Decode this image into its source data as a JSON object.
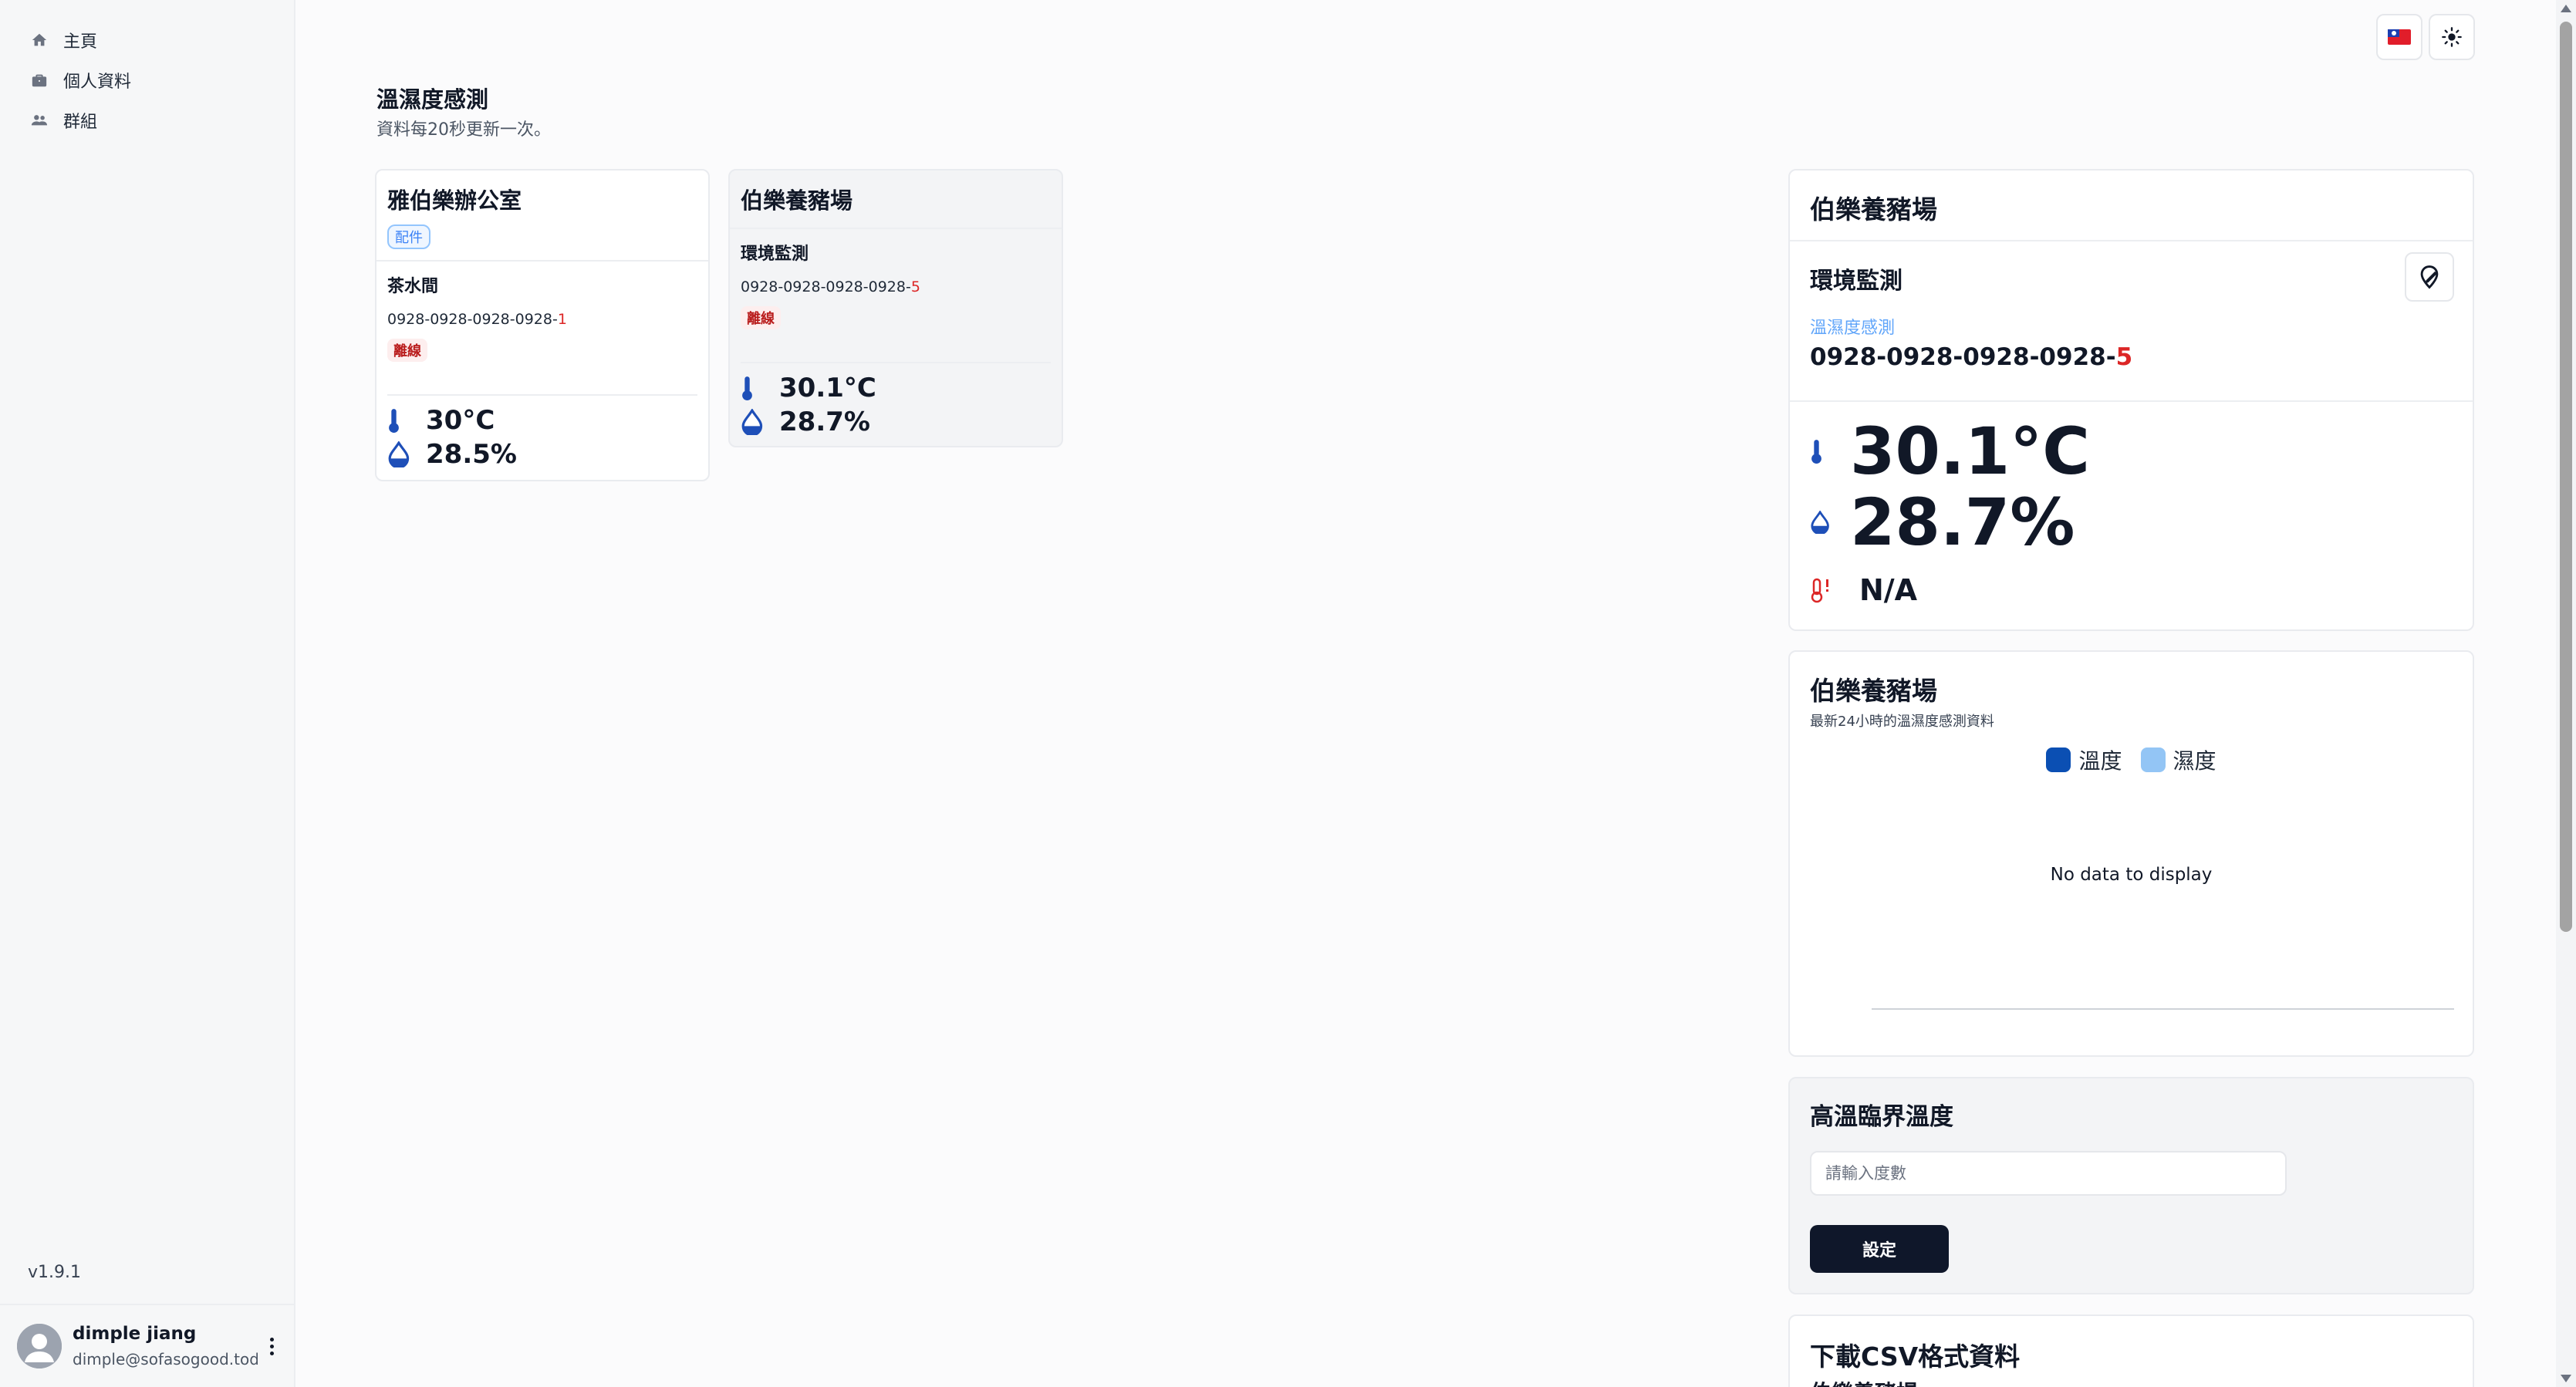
{
  "sidebar": {
    "items": [
      {
        "label": "主頁",
        "icon": "home-icon"
      },
      {
        "label": "個人資料",
        "icon": "briefcase-icon"
      },
      {
        "label": "群組",
        "icon": "group-icon"
      }
    ],
    "version": "v1.9.1",
    "user": {
      "name": "dimple jiang",
      "email": "dimple@sofasogood.today"
    }
  },
  "header": {
    "title": "溫濕度感測",
    "subtitle": "資料每20秒更新一次。"
  },
  "cards": [
    {
      "title": "雅伯樂辦公室",
      "tag": "配件",
      "sub_name": "茶水間",
      "serial_prefix": "0928-0928-0928-0928-",
      "serial_suffix": "1",
      "status": "離線",
      "temperature": "30°C",
      "humidity": "28.5%"
    },
    {
      "title": "伯樂養豬場",
      "sub_name": "環境監測",
      "serial_prefix": "0928-0928-0928-0928-",
      "serial_suffix": "5",
      "status": "離線",
      "temperature": "30.1°C",
      "humidity": "28.7%"
    }
  ],
  "detail": {
    "title": "伯樂養豬場",
    "section_name": "環境監測",
    "link": "溫濕度感測",
    "serial_prefix": "0928-0928-0928-0928-",
    "serial_suffix": "5",
    "temperature": "30.1°C",
    "humidity": "28.7%",
    "alert": "N/A"
  },
  "chart": {
    "title": "伯樂養豬場",
    "subtitle": "最新24小時的溫濕度感測資料",
    "legend": [
      {
        "name": "溫度",
        "color": "#0b4fb3"
      },
      {
        "name": "濕度",
        "color": "#93c5f5"
      }
    ],
    "empty_text": "No data to display"
  },
  "chart_data": {
    "type": "line",
    "title": "伯樂養豬場",
    "subtitle": "最新24小時的溫濕度感測資料",
    "series": [
      {
        "name": "溫度",
        "values": []
      },
      {
        "name": "濕度",
        "values": []
      }
    ],
    "legend": "top-center"
  },
  "threshold": {
    "title": "高溫臨界溫度",
    "placeholder": "請輸入度數",
    "button": "設定"
  },
  "csv": {
    "title": "下載CSV格式資料",
    "subtitle": "伯樂養豬場"
  },
  "colors": {
    "accent": "#0f172a",
    "temp_icon": "#1e4fb8",
    "alert": "#dc2626",
    "link": "#60a5fa"
  }
}
